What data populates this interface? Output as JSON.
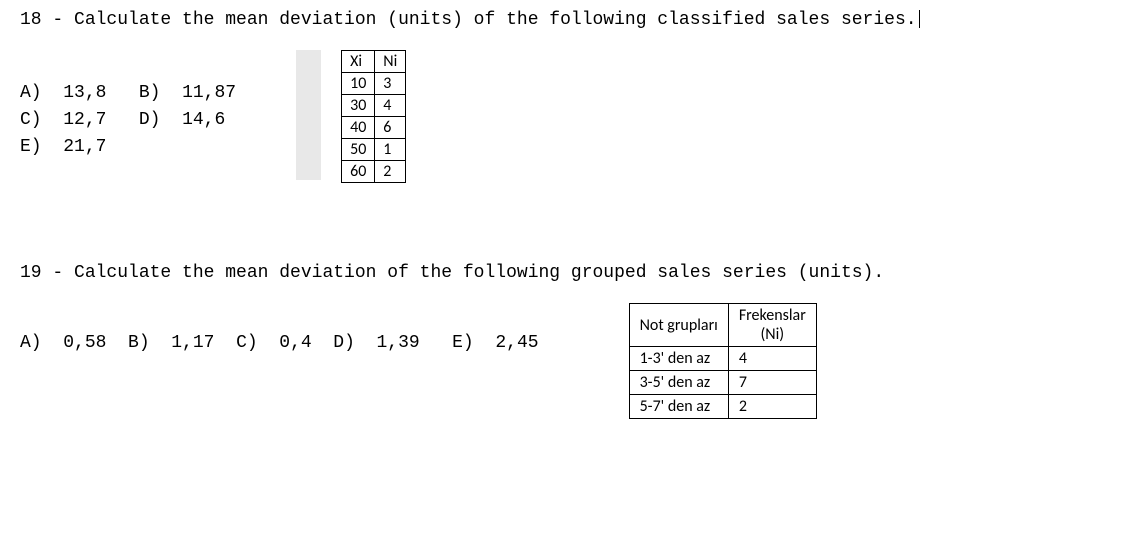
{
  "q18": {
    "number": "18",
    "prompt": "Calculate the mean deviation (units) of the following classified sales series.",
    "answers": {
      "a": "13,8",
      "b": "11,87",
      "c": "12,7",
      "d": "14,6",
      "e": "21,7"
    },
    "table": {
      "headers": {
        "col1": "Xi",
        "col2": "Ni"
      },
      "rows": [
        {
          "xi": "10",
          "ni": "3"
        },
        {
          "xi": "30",
          "ni": "4"
        },
        {
          "xi": "40",
          "ni": "6"
        },
        {
          "xi": "50",
          "ni": "1"
        },
        {
          "xi": "60",
          "ni": "2"
        }
      ]
    }
  },
  "q19": {
    "number": "19",
    "prompt": "Calculate the mean deviation of the following grouped sales series (units).",
    "answers": {
      "a": "0,58",
      "b": "1,17",
      "c": "0,4",
      "d": "1,39",
      "e": "2,45"
    },
    "table": {
      "headers": {
        "col1": "Not grupları",
        "col2_line1": "Frekenslar",
        "col2_line2": "(Ni)"
      },
      "rows": [
        {
          "group": "1-3' den az",
          "freq": "4"
        },
        {
          "group": "3-5' den az",
          "freq": "7"
        },
        {
          "group": "5-7' den az",
          "freq": "2"
        }
      ]
    }
  }
}
